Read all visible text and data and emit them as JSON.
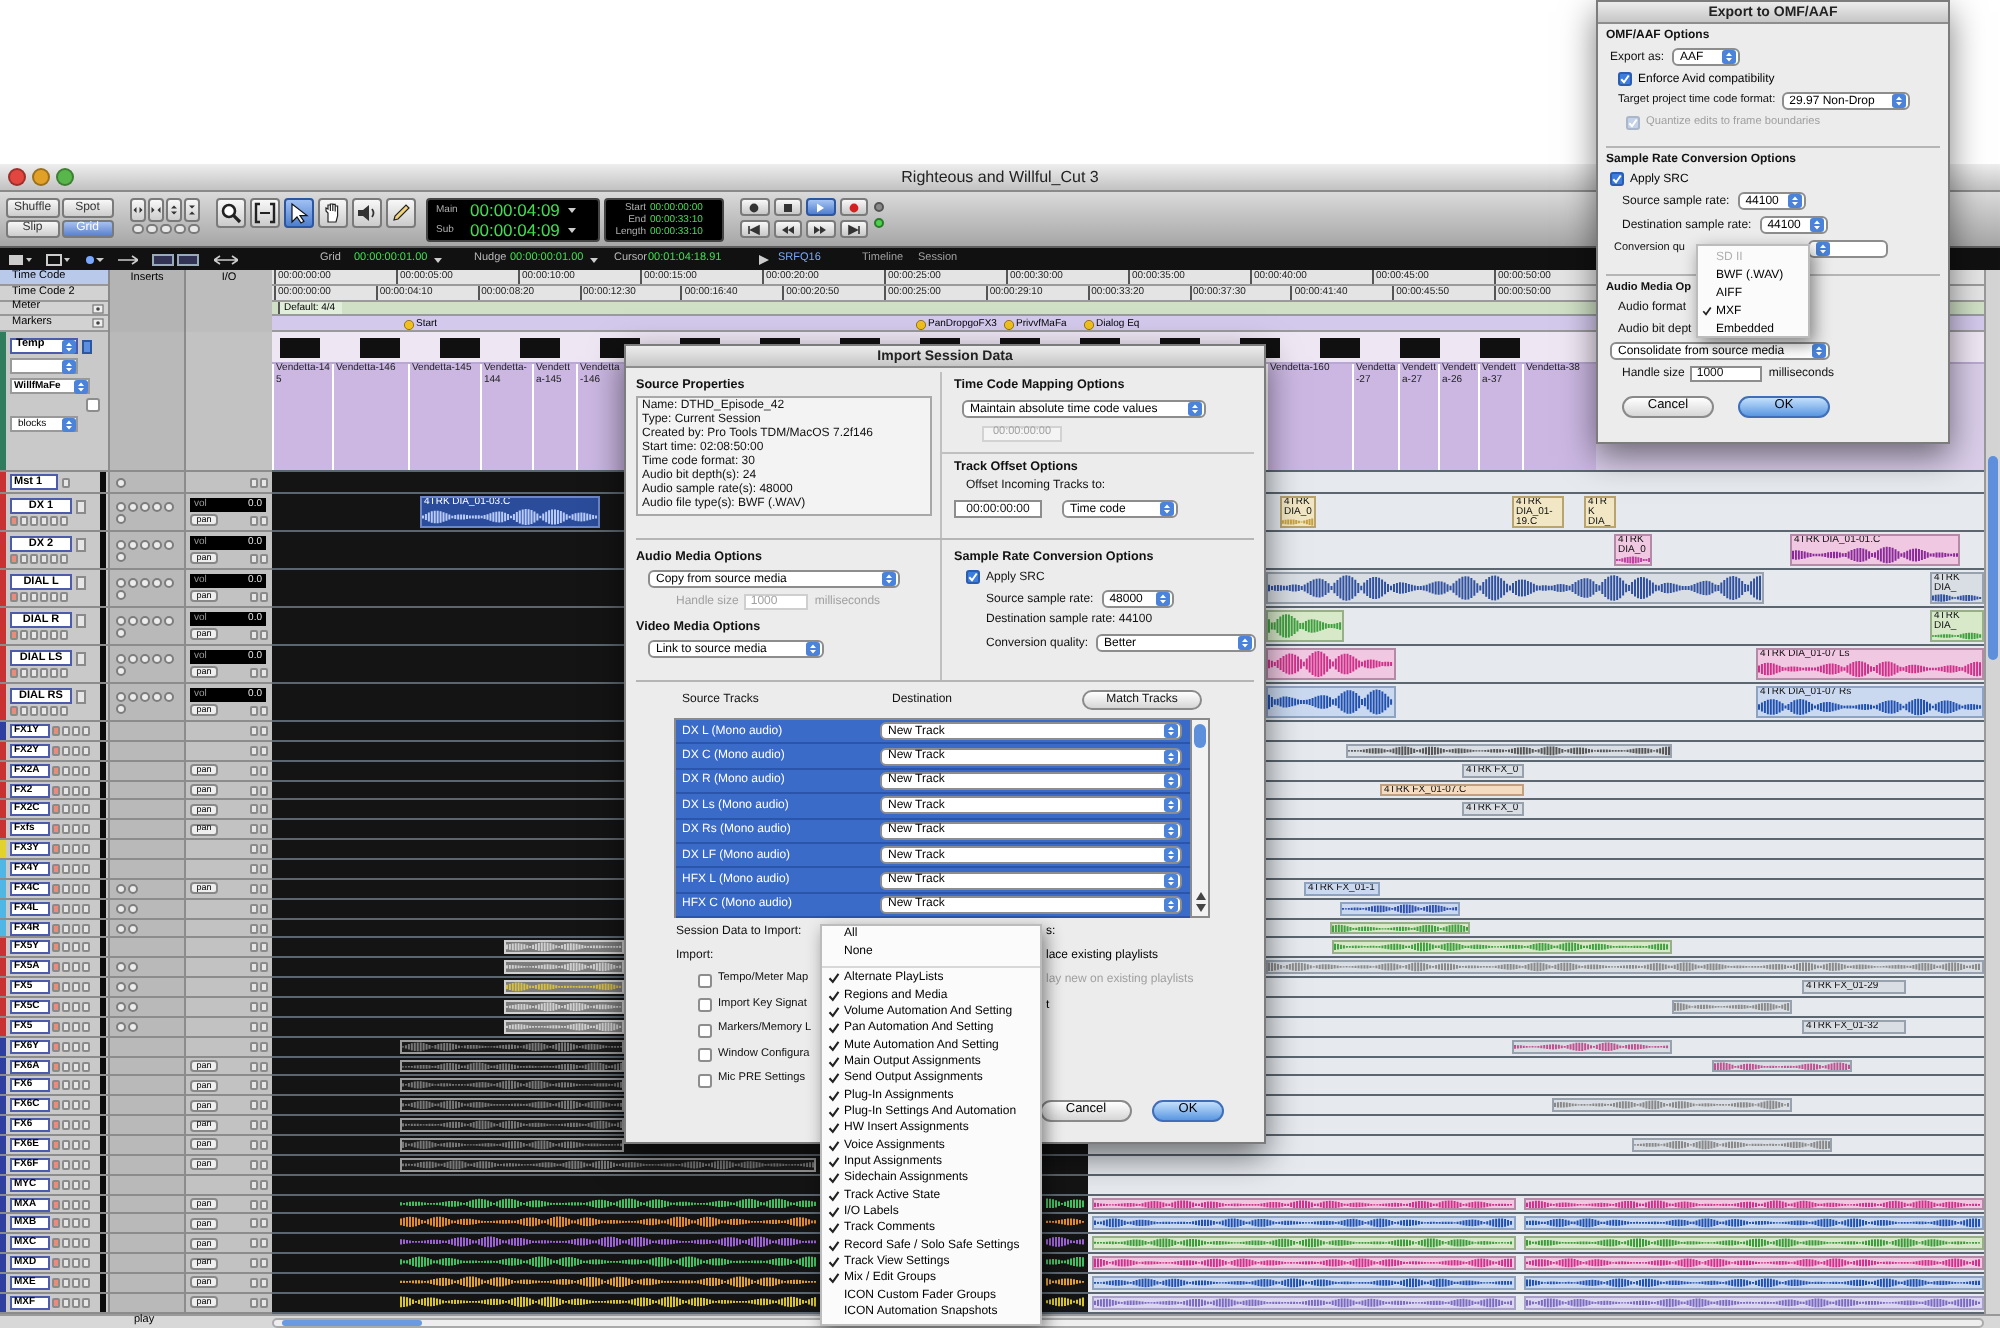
{
  "window": {
    "title": "Righteous and Willful_Cut 3"
  },
  "toolbar": {
    "edit_modes": [
      {
        "label": "Shuffle",
        "selected": false
      },
      {
        "label": "Spot",
        "selected": false
      },
      {
        "label": "Slip",
        "selected": false
      },
      {
        "label": "Grid",
        "selected": true
      }
    ],
    "tools": [
      {
        "kind": "zoom",
        "selected": false
      },
      {
        "kind": "trim",
        "selected": false
      },
      {
        "kind": "smart",
        "selected": true
      },
      {
        "kind": "grab",
        "selected": false
      },
      {
        "kind": "scrub",
        "selected": false
      },
      {
        "kind": "pencil",
        "selected": false
      }
    ],
    "counters": [
      {
        "label": "Main",
        "value": "00:00:04:09"
      },
      {
        "label": "Sub",
        "value": "00:00:04:09"
      }
    ],
    "selection": [
      {
        "label": "Start",
        "value": "00:00:00:00"
      },
      {
        "label": "End",
        "value": "00:00:33:10"
      },
      {
        "label": "Length",
        "value": "00:00:33:10"
      }
    ],
    "transport": [
      {
        "kind": "online",
        "selected": false
      },
      {
        "kind": "stop",
        "selected": false
      },
      {
        "kind": "play",
        "selected": true
      },
      {
        "kind": "record",
        "selected": false
      },
      {
        "kind": "start",
        "selected": false
      },
      {
        "kind": "rewind",
        "selected": false
      },
      {
        "kind": "forward",
        "selected": false
      },
      {
        "kind": "end",
        "selected": false
      }
    ]
  },
  "edit_bar": {
    "fields": [
      {
        "label": "Grid",
        "value": "00:00:00:01.00"
      },
      {
        "label": "Nudge",
        "value": "00:00:00:01.00"
      },
      {
        "label": "Cursor",
        "value": "00:01:04:18.91"
      }
    ],
    "sample": "SRFQ16",
    "labels": [
      "Timeline",
      "Session"
    ]
  },
  "rulers": [
    {
      "kind": "timecode",
      "name": "Time Code",
      "selected": true,
      "ticks": [
        "00:00:00:00",
        "00:00:05:00",
        "00:00:10:00",
        "00:00:15:00",
        "00:00:20:00",
        "00:00:25:00",
        "00:00:30:00",
        "00:00:35:00",
        "00:00:40:00",
        "00:00:45:00",
        "00:00:50:00"
      ]
    },
    {
      "kind": "timecode",
      "name": "Time Code 2",
      "selected": false,
      "ticks": [
        "00:00:00:00",
        "00:00:04:10",
        "00:00:08:20",
        "00:00:12:30",
        "00:00:16:40",
        "00:00:20:50",
        "00:00:25:00",
        "00:00:29:10",
        "00:00:33:20",
        "00:00:37:30",
        "00:00:41:40",
        "00:00:45:50",
        "00:00:50:00"
      ]
    },
    {
      "kind": "meter",
      "name": "Meter",
      "selected": false,
      "marks": [
        "Default: 4/4"
      ]
    },
    {
      "kind": "markers",
      "name": "Markers",
      "selected": false,
      "marks": [
        "Start",
        "PanDropgoFX3",
        "PrivvfMaFa",
        "Dialog Eq"
      ]
    }
  ],
  "column_headers": [
    "Inserts",
    "I/O"
  ],
  "temp_track": {
    "name": "Temp",
    "playlist": "WillfMaFe",
    "view": "blocks",
    "checked": false,
    "color": "#2f7d5d",
    "regions": [
      {
        "label": "Vendetta-145"
      },
      {
        "label": "Vendetta-146"
      },
      {
        "label": "Vendetta-145"
      },
      {
        "label": "Vendetta-144"
      },
      {
        "label": "Vendetta-145"
      },
      {
        "label": "Vendetta-146"
      },
      {
        "label": "Vendetta-160"
      },
      {
        "label": "Vendetta-27"
      },
      {
        "label": "Vendetta-27"
      },
      {
        "label": "Vendetta-26"
      },
      {
        "label": "Vendetta-37"
      },
      {
        "label": "Vendetta-38"
      }
    ]
  },
  "tracks": [
    {
      "kind": "master",
      "name": "Mst 1",
      "color": "#c83232"
    },
    {
      "kind": "tall",
      "name": "DX 1",
      "color": "#c83232",
      "volume_label": "vol",
      "volume": "0.0",
      "pan_label": "pan",
      "regions": [
        {
          "label": "4TRK DIA_01-03.C"
        },
        {
          "label": "4TRK DIA_0"
        },
        {
          "label": "4TRK DIA_01-19.C"
        },
        {
          "label": "4TRK DIA_"
        }
      ]
    },
    {
      "kind": "tall",
      "name": "DX 2",
      "color": "#c83232",
      "volume_label": "vol",
      "volume": "0.0",
      "pan_label": "pan",
      "regions": [
        {
          "label": "4TRK DIA_0"
        },
        {
          "label": "4TRK DIA_01-01.C"
        }
      ]
    },
    {
      "kind": "tall",
      "name": "DIAL L",
      "color": "#c83232",
      "volume_label": "vol",
      "volume": "0.0",
      "pan_label": "pan",
      "regions": [
        {
          "label": "4TRK DIA_"
        }
      ]
    },
    {
      "kind": "tall",
      "name": "DIAL R",
      "color": "#c83232",
      "volume_label": "vol",
      "volume": "0.0",
      "pan_label": "pan",
      "regions": [
        {
          "label": "4TRK DIA_"
        }
      ]
    },
    {
      "kind": "tall",
      "name": "DIAL LS",
      "color": "#c83232",
      "volume_label": "vol",
      "volume": "0.0",
      "pan_label": "pan",
      "regions": [
        {
          "label": "4TRK DIA_01-07 Ls"
        }
      ]
    },
    {
      "kind": "tall",
      "name": "DIAL RS",
      "color": "#c83232",
      "volume_label": "vol",
      "volume": "0.0",
      "pan_label": "pan",
      "regions": [
        {
          "label": "4TRK DIA_01-07 Rs"
        }
      ]
    },
    {
      "kind": "short",
      "name": "FX1Y",
      "color": "#2f3f9f",
      "inserts": false
    },
    {
      "kind": "short",
      "name": "FX2Y",
      "color": "#c83232",
      "inserts": false
    },
    {
      "kind": "short",
      "name": "FX2A",
      "color": "#c83232",
      "inserts": false,
      "pan_label": "pan",
      "regions": [
        {
          "label": "4TRK FX_0"
        }
      ]
    },
    {
      "kind": "short",
      "name": "FX2",
      "color": "#c83232",
      "inserts": false,
      "pan_label": "pan",
      "regions": [
        {
          "label": "4TRK FX_01-07.C"
        }
      ]
    },
    {
      "kind": "short",
      "name": "FX2C",
      "color": "#c83232",
      "inserts": false,
      "pan_label": "pan",
      "regions": [
        {
          "label": "4TRK FX_0"
        }
      ]
    },
    {
      "kind": "short",
      "name": "Fxfs",
      "color": "#c83232",
      "inserts": false,
      "pan_label": "pan"
    },
    {
      "kind": "short",
      "name": "FX3Y",
      "color": "#e2d230",
      "inserts": false
    },
    {
      "kind": "short",
      "name": "FX4Y",
      "color": "#4fb6e6",
      "inserts": false
    },
    {
      "kind": "short",
      "name": "FX4C",
      "color": "#4fb6e6",
      "inserts": true,
      "pan_label": "pan",
      "regions": [
        {
          "label": "4TRK FX_01-1"
        }
      ]
    },
    {
      "kind": "short",
      "name": "FX4L",
      "color": "#4fb6e6",
      "inserts": true
    },
    {
      "kind": "short",
      "name": "FX4R",
      "color": "#4fb6e6",
      "inserts": true
    },
    {
      "kind": "short",
      "name": "FX5Y",
      "color": "#c83232",
      "inserts": false
    },
    {
      "kind": "short",
      "name": "FX5A",
      "color": "#c83232",
      "inserts": true
    },
    {
      "kind": "short",
      "name": "FX5",
      "color": "#c83232",
      "inserts": true,
      "regions": [
        {
          "label": "4TRK FX_01-29"
        }
      ]
    },
    {
      "kind": "short",
      "name": "FX5C",
      "color": "#c83232",
      "inserts": true
    },
    {
      "kind": "short",
      "name": "FX5",
      "color": "#c83232",
      "inserts": true,
      "regions": [
        {
          "label": "4TRK FX_01-32"
        }
      ]
    },
    {
      "kind": "short",
      "name": "FX6Y",
      "color": "#2f3f9f",
      "inserts": false
    },
    {
      "kind": "short",
      "name": "FX6A",
      "color": "#2f3f9f",
      "inserts": false,
      "pan_label": "pan"
    },
    {
      "kind": "short",
      "name": "FX6",
      "color": "#2f3f9f",
      "inserts": false,
      "pan_label": "pan"
    },
    {
      "kind": "short",
      "name": "FX6C",
      "color": "#2f3f9f",
      "inserts": false,
      "pan_label": "pan"
    },
    {
      "kind": "short",
      "name": "FX6",
      "color": "#2f3f9f",
      "inserts": false,
      "pan_label": "pan"
    },
    {
      "kind": "short",
      "name": "FX6E",
      "color": "#2f3f9f",
      "inserts": false,
      "pan_label": "pan"
    },
    {
      "kind": "short",
      "name": "FX6F",
      "color": "#2f3f9f",
      "inserts": false,
      "pan_label": "pan"
    },
    {
      "kind": "short",
      "name": "MYC",
      "color": "#2f3f9f",
      "inserts": false
    },
    {
      "kind": "short",
      "name": "MXA",
      "color": "#2f3f9f",
      "inserts": false,
      "pan_label": "pan"
    },
    {
      "kind": "short",
      "name": "MXB",
      "color": "#2f3f9f",
      "inserts": false,
      "pan_label": "pan"
    },
    {
      "kind": "short",
      "name": "MXC",
      "color": "#2f3f9f",
      "inserts": false,
      "pan_label": "pan"
    },
    {
      "kind": "short",
      "name": "MXD",
      "color": "#2f3f9f",
      "inserts": false,
      "pan_label": "pan"
    },
    {
      "kind": "short",
      "name": "MXE",
      "color": "#2f3f9f",
      "inserts": false,
      "pan_label": "pan"
    },
    {
      "kind": "short",
      "name": "MXF",
      "color": "#2f3f9f",
      "inserts": false,
      "pan_label": "pan"
    }
  ],
  "status_bar": {
    "text": "play"
  },
  "import_dialog": {
    "title": "Import Session Data",
    "source_properties": {
      "heading": "Source Properties",
      "lines": [
        "Name: DTHD_Episode_42",
        "Type: Current Session",
        "Created by: Pro Tools TDM/MacOS 7.2f146",
        "Start time: 02:08:50:00",
        "Time code format: 30",
        "Audio bit depth(s): 24",
        "Audio sample rate(s): 48000",
        "Audio file type(s): BWF (.WAV)"
      ]
    },
    "time_code_mapping": {
      "heading": "Time Code Mapping Options",
      "option": "Maintain absolute time code values",
      "value": "00:00:00:00",
      "disabled": true
    },
    "track_offset": {
      "heading": "Track Offset Options",
      "label": "Offset Incoming Tracks to:",
      "value": "00:00:00:00",
      "unit": "Time code"
    },
    "audio_media": {
      "heading": "Audio Media Options",
      "option": "Copy from source media",
      "handle_label": "Handle size",
      "handle": "1000",
      "handle_unit": "milliseconds",
      "disabled": true
    },
    "video_media": {
      "heading": "Video Media Options",
      "option": "Link to source media"
    },
    "sample_rate": {
      "heading": "Sample Rate Conversion Options",
      "apply": {
        "label": "Apply SRC",
        "checked": true
      },
      "source_label": "Source sample rate:",
      "source": "48000",
      "destination": "Destination sample rate: 44100",
      "quality_label": "Conversion quality:",
      "quality": "Better"
    },
    "tracks_header": {
      "source": "Source Tracks",
      "destination": "Destination",
      "button": "Match Tracks"
    },
    "source_tracks": [
      {
        "name": "DX L (Mono audio)",
        "destination": "New Track",
        "selected": true
      },
      {
        "name": "DX C (Mono audio)",
        "destination": "New Track",
        "selected": true
      },
      {
        "name": "DX R (Mono audio)",
        "destination": "New Track",
        "selected": true
      },
      {
        "name": "DX Ls (Mono audio)",
        "destination": "New Track",
        "selected": true
      },
      {
        "name": "DX Rs (Mono audio)",
        "destination": "New Track",
        "selected": true
      },
      {
        "name": "DX LF (Mono audio)",
        "destination": "New Track",
        "selected": true
      },
      {
        "name": "HFX L (Mono audio)",
        "destination": "New Track",
        "selected": true
      },
      {
        "name": "HFX C (Mono audio)",
        "destination": "New Track",
        "selected": true
      }
    ],
    "session_data_label": "Session Data to Import:",
    "playlist_options": [
      {
        "text": "s:",
        "disabled": false
      },
      {
        "text": "lace existing playlists",
        "disabled": false
      },
      {
        "text": "lay new on existing playlists",
        "disabled": true
      },
      {
        "text": "t",
        "disabled": false
      }
    ],
    "import_label": "Import:",
    "import_options": [
      {
        "label": "Tempo/Meter Map",
        "checked": false
      },
      {
        "label": "Import Key Signat",
        "checked": false
      },
      {
        "label": "Markers/Memory L",
        "checked": false
      },
      {
        "label": "Window Configura",
        "checked": false
      },
      {
        "label": "Mic PRE Settings",
        "checked": false
      }
    ],
    "buttons": [
      {
        "label": "Cancel",
        "default": false
      },
      {
        "label": "OK",
        "default": true
      }
    ]
  },
  "import_menu": {
    "items": [
      {
        "kind": "plain",
        "label": "All"
      },
      {
        "kind": "plain",
        "label": "None"
      },
      {
        "kind": "separator"
      },
      {
        "kind": "option",
        "label": "Alternate PlayLists",
        "checked": true
      },
      {
        "kind": "option",
        "label": "Regions and Media",
        "checked": true
      },
      {
        "kind": "option",
        "label": "Volume Automation And Setting",
        "checked": true
      },
      {
        "kind": "option",
        "label": "Pan Automation And Setting",
        "checked": true
      },
      {
        "kind": "option",
        "label": "Mute Automation And Setting",
        "checked": true
      },
      {
        "kind": "option",
        "label": "Main Output Assignments",
        "checked": true
      },
      {
        "kind": "option",
        "label": "Send Output Assignments",
        "checked": true
      },
      {
        "kind": "option",
        "label": "Plug-In Assignments",
        "checked": true
      },
      {
        "kind": "option",
        "label": "Plug-In Settings And Automation",
        "checked": true
      },
      {
        "kind": "option",
        "label": "HW Insert Assignments",
        "checked": true
      },
      {
        "kind": "option",
        "label": "Voice Assignments",
        "checked": true
      },
      {
        "kind": "option",
        "label": "Input Assignments",
        "checked": true
      },
      {
        "kind": "option",
        "label": "Sidechain Assignments",
        "checked": true
      },
      {
        "kind": "option",
        "label": "Track Active State",
        "checked": true
      },
      {
        "kind": "option",
        "label": "I/O Labels",
        "checked": true
      },
      {
        "kind": "option",
        "label": "Track Comments",
        "checked": true
      },
      {
        "kind": "option",
        "label": "Record Safe / Solo Safe Settings",
        "checked": true
      },
      {
        "kind": "option",
        "label": "Track View Settings",
        "checked": true
      },
      {
        "kind": "option",
        "label": "Mix / Edit Groups",
        "checked": true
      },
      {
        "kind": "option",
        "label": "ICON Custom Fader Groups",
        "checked": false
      },
      {
        "kind": "option",
        "label": "ICON Automation Snapshots",
        "checked": false
      }
    ]
  },
  "export_dialog": {
    "title": "Export to OMF/AAF",
    "omf_options": {
      "heading": "OMF/AAF Options",
      "export_label": "Export as:",
      "export_as": "AAF",
      "avid": {
        "label": "Enforce Avid compatibility",
        "checked": true,
        "disabled": false
      },
      "timecode_label": "Target project time code format:",
      "timecode": "29.97 Non-Drop",
      "quantize": {
        "label": "Quantize edits to frame boundaries",
        "checked": true,
        "disabled": true
      }
    },
    "sample_rate": {
      "heading": "Sample Rate Conversion Options",
      "apply": {
        "label": "Apply SRC",
        "checked": true,
        "disabled": false
      },
      "source_label": "Source sample rate:",
      "source": "44100",
      "destination_label": "Destination sample rate:",
      "destination": "44100",
      "quality_label": "Conversion qu"
    },
    "audio_media": {
      "heading": "Audio Media Op",
      "format_label": "Audio format",
      "bit_depth_label": "Audio bit dept",
      "option": "Consolidate from source media",
      "handle_label": "Handle size",
      "handle": "1000",
      "handle_unit": "milliseconds"
    },
    "buttons": [
      {
        "label": "Cancel",
        "default": false
      },
      {
        "label": "OK",
        "default": true
      }
    ]
  },
  "format_menu": {
    "items": [
      {
        "label": "SD II",
        "checked": false,
        "disabled": true
      },
      {
        "label": "BWF (.WAV)",
        "checked": false,
        "disabled": false
      },
      {
        "label": "AIFF",
        "checked": false,
        "disabled": false
      },
      {
        "label": "MXF",
        "checked": true,
        "disabled": false
      },
      {
        "label": "Embedded",
        "checked": false,
        "disabled": false
      }
    ]
  }
}
